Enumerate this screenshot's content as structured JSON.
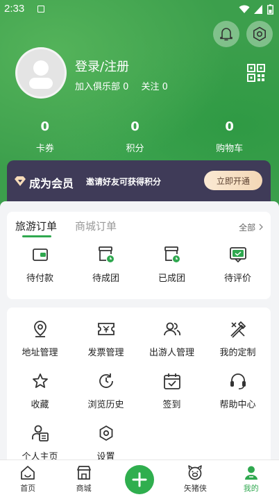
{
  "status_bar": {
    "time": "2:33"
  },
  "profile": {
    "login_text": "登录/注册",
    "club_label": "加入俱乐部",
    "club_count": "0",
    "follow_label": "关注",
    "follow_count": "0"
  },
  "stats": [
    {
      "value": "0",
      "label": "卡券"
    },
    {
      "value": "0",
      "label": "积分"
    },
    {
      "value": "0",
      "label": "购物车"
    }
  ],
  "vip": {
    "title": "成为会员",
    "desc": "邀请好友可获得积分",
    "button": "立即开通"
  },
  "orders": {
    "tabs": [
      "旅游订单",
      "商城订单"
    ],
    "all_label": "全部",
    "items": [
      {
        "label": "待付款",
        "icon": "wallet-icon"
      },
      {
        "label": "待成团",
        "icon": "group-pending-icon"
      },
      {
        "label": "已成团",
        "icon": "group-done-icon"
      },
      {
        "label": "待评价",
        "icon": "review-icon"
      }
    ]
  },
  "services": [
    {
      "label": "地址管理",
      "icon": "location-icon"
    },
    {
      "label": "发票管理",
      "icon": "invoice-icon"
    },
    {
      "label": "出游人管理",
      "icon": "travelers-icon"
    },
    {
      "label": "我的定制",
      "icon": "customize-icon"
    },
    {
      "label": "收藏",
      "icon": "star-icon"
    },
    {
      "label": "浏览历史",
      "icon": "history-icon"
    },
    {
      "label": "签到",
      "icon": "checkin-icon"
    },
    {
      "label": "帮助中心",
      "icon": "headset-icon"
    },
    {
      "label": "个人主页",
      "icon": "profile-page-icon"
    },
    {
      "label": "设置",
      "icon": "settings-icon"
    }
  ],
  "tabbar": [
    {
      "label": "首页",
      "icon": "home-icon"
    },
    {
      "label": "商城",
      "icon": "shop-icon"
    },
    {
      "label": "",
      "icon": "plus-icon"
    },
    {
      "label": "矢猪侠",
      "icon": "pig-icon"
    },
    {
      "label": "我的",
      "icon": "user-icon"
    }
  ],
  "colors": {
    "accent": "#2fa84f",
    "vip_bg": "#3f3b58"
  }
}
